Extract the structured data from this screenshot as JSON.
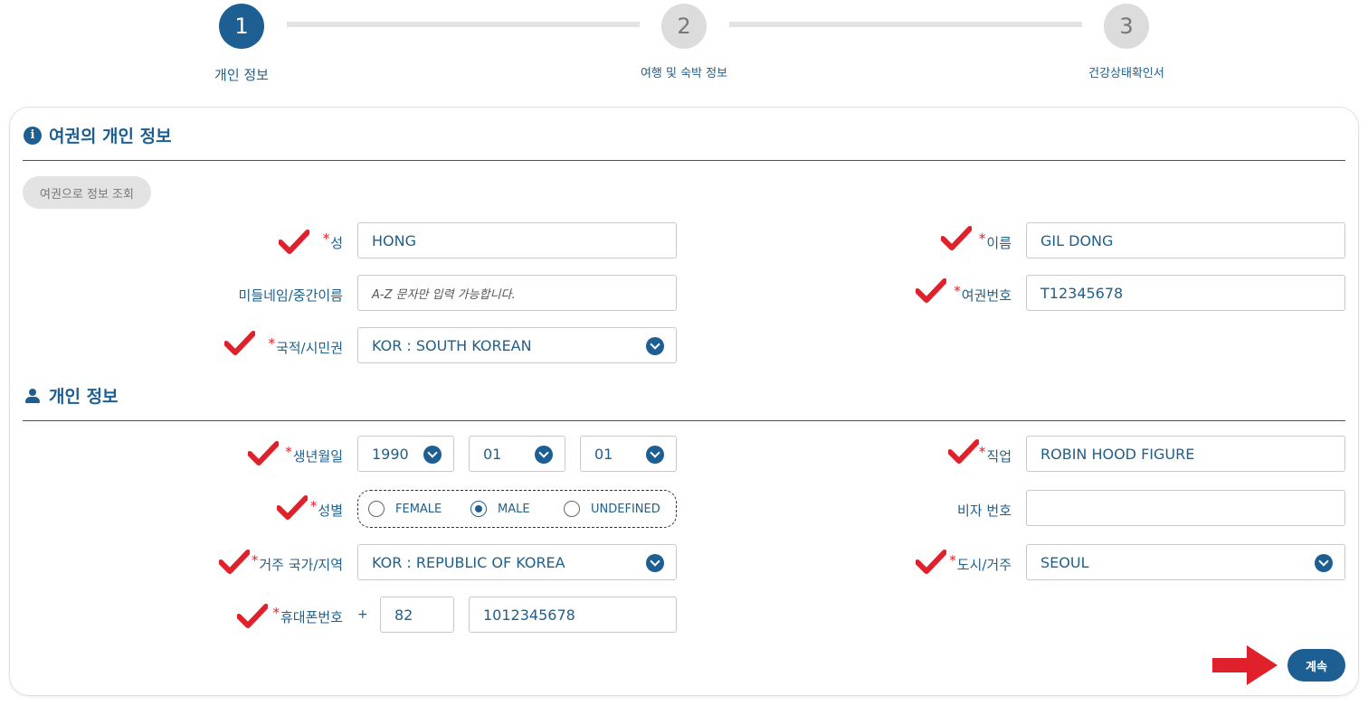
{
  "stepper": {
    "steps": [
      {
        "number": "1",
        "label": "개인 정보",
        "active": true
      },
      {
        "number": "2",
        "label": "여행 및 숙박 정보",
        "active": false
      },
      {
        "number": "3",
        "label": "건강상태확인서",
        "active": false
      }
    ]
  },
  "passport_section": {
    "title": "여권의 개인 정보",
    "icon": "info-icon",
    "lookup_button": "여권으로 정보 조회",
    "fields": {
      "surname": {
        "label": "성",
        "value": "HONG"
      },
      "given_name": {
        "label": "이름",
        "value": "GIL DONG"
      },
      "middle_name": {
        "label": "미들네임/중간이름",
        "placeholder": "A-Z 문자만 입력 가능합니다."
      },
      "passport_number": {
        "label": "여권번호",
        "value": "T12345678"
      },
      "nationality": {
        "label": "국적/시민권",
        "value": "KOR : SOUTH KOREAN"
      }
    }
  },
  "personal_section": {
    "title": "개인 정보",
    "icon": "person-icon",
    "fields": {
      "birth_date": {
        "label": "생년월일",
        "year": "1990",
        "month": "01",
        "day": "01"
      },
      "occupation": {
        "label": "직업",
        "value": "ROBIN HOOD FIGURE"
      },
      "gender": {
        "label": "성별",
        "options": [
          "FEMALE",
          "MALE",
          "UNDEFINED"
        ],
        "selected": "MALE"
      },
      "visa_number": {
        "label": "비자 번호",
        "value": ""
      },
      "residence_country": {
        "label": "거주 국가/지역",
        "value": "KOR : REPUBLIC OF KOREA"
      },
      "city": {
        "label": "도시/거주",
        "value": "SEOUL"
      },
      "mobile": {
        "label": "휴대폰번호",
        "plus": "+",
        "country_code": "82",
        "number": "1012345678"
      }
    }
  },
  "continue_button": "계속",
  "colors": {
    "primary": "#1e5f93",
    "required_mark": "#e0202a",
    "annotation_red": "#e0202a",
    "inactive_step": "#dcdcdc"
  }
}
